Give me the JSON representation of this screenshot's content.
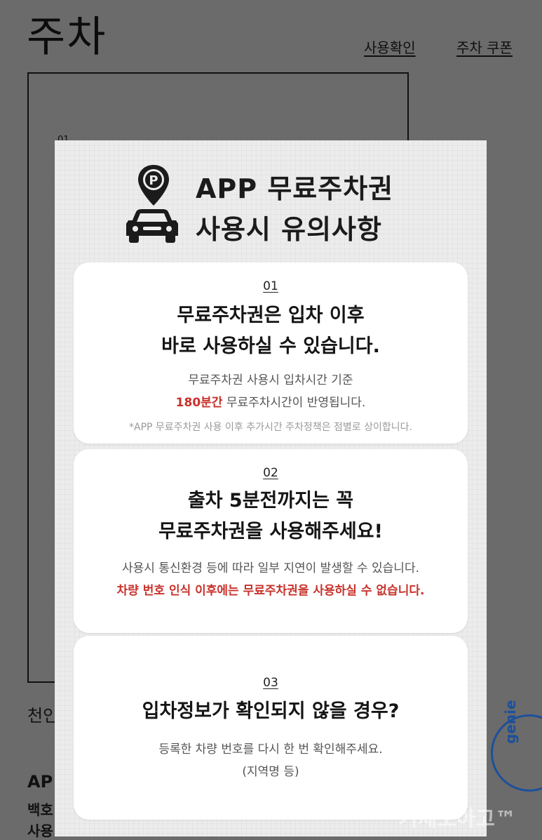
{
  "background": {
    "title": "주차",
    "links": {
      "usage": "사용확인",
      "coupon": "주차 쿠폰"
    },
    "box_number": "01",
    "under_lines": [
      "천인",
      "AP",
      "백호",
      "사용"
    ],
    "badge_text": "genie",
    "watermark": "거제오아고™"
  },
  "popup": {
    "title_line1": "APP 무료주차권",
    "title_line2": "사용시 유의사항",
    "accent_color": "#c8312b",
    "cards": [
      {
        "number": "01",
        "headline_1": "무료주차권은 입차 이후",
        "headline_2": "바로 사용하실 수 있습니다.",
        "text_1": "무료주차권 사용시 입차시간 기준",
        "highlight": "180분간",
        "text_2": " 무료주차시간이 반영됩니다.",
        "note": "*APP 무료주차권 사용 이후 추가시간 주차정책은 점별로 상이합니다."
      },
      {
        "number": "02",
        "headline_1": "출차 5분전까지는 꼭",
        "headline_2": "무료주차권을 사용해주세요!",
        "text_1": "사용시 통신환경 등에 따라 일부 지연이 발생할 수 있습니다.",
        "warning": "차량 번호 인식 이후에는 무료주차권을 사용하실 수 없습니다."
      },
      {
        "number": "03",
        "headline_1": "입차정보가 확인되지 않을 경우?",
        "text_1": "등록한 차량 번호를 다시 한 번 확인해주세요.",
        "text_2": "(지역명 등)"
      }
    ]
  }
}
